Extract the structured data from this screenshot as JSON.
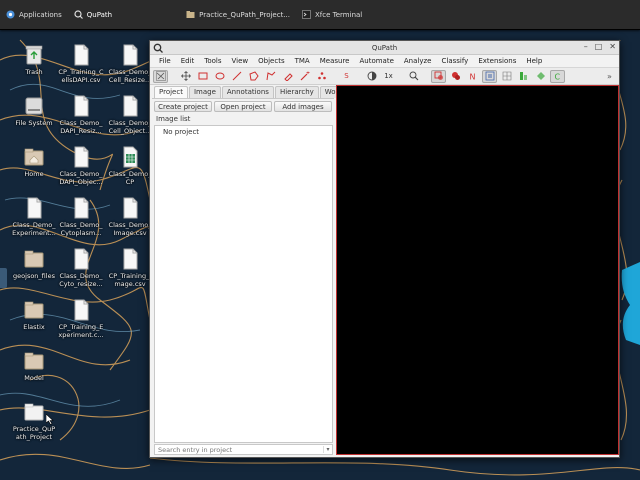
{
  "taskbar": {
    "items": [
      {
        "label": "Applications",
        "icon": "app-menu-icon"
      },
      {
        "label": "QuPath",
        "icon": "qupath-icon"
      },
      {
        "label": "Practice_QuPath_Project...",
        "icon": "folder-icon"
      },
      {
        "label": "Xfce Terminal",
        "icon": "terminal-icon"
      }
    ]
  },
  "desktop": {
    "icons": [
      {
        "label": "Trash",
        "type": "trash"
      },
      {
        "label": "CP_Training_C ellsDAPI.csv",
        "type": "file"
      },
      {
        "label": "Class_Demo_ Cell_Resize...",
        "type": "file"
      },
      {
        "label": "File System",
        "type": "drive"
      },
      {
        "label": "Class_Demo_ DAPI_Resiz...",
        "type": "file"
      },
      {
        "label": "Class_Demo_ Cell_Object...",
        "type": "file"
      },
      {
        "label": "Home",
        "type": "home"
      },
      {
        "label": "Class_Demo_ DAPI_Objec...",
        "type": "file"
      },
      {
        "label": "Class_Demo_ CP",
        "type": "sheet"
      },
      {
        "label": "Class_Demo_ Experiment...",
        "type": "file"
      },
      {
        "label": "Class_Demo_ Cytoplasm...",
        "type": "file"
      },
      {
        "label": "Class_Demo_ Image.csv",
        "type": "file"
      },
      {
        "label": "geojson_files",
        "type": "folder"
      },
      {
        "label": "Class_Demo_ Cyto_resize...",
        "type": "file"
      },
      {
        "label": "CP_Training_I mage.csv",
        "type": "file"
      },
      {
        "label": "Elastix",
        "type": "folder"
      },
      {
        "label": "CP_Training_E xperiment.c...",
        "type": "file"
      },
      {
        "label": "Model",
        "type": "folder"
      },
      {
        "label": "Practice_QuP ath_Project",
        "type": "folder-open"
      }
    ]
  },
  "window": {
    "title": "QuPath",
    "controls": {
      "minimize": "–",
      "maximize": "□",
      "close": "✕"
    },
    "menu": [
      "File",
      "Edit",
      "Tools",
      "View",
      "Objects",
      "TMA",
      "Measure",
      "Automate",
      "Analyze",
      "Classify",
      "Extensions",
      "Help"
    ],
    "toolbar": {
      "tools": [
        "move-tool-icon",
        "rectangle-tool-icon",
        "ellipse-tool-icon",
        "line-tool-icon",
        "polygon-tool-icon",
        "polyline-tool-icon",
        "brush-tool-icon",
        "wand-tool-icon",
        "points-tool-icon"
      ],
      "selection_mode_label": "S",
      "zoom_label": "1x",
      "more_label": "»"
    },
    "left_tabs": [
      "Project",
      "Image",
      "Annotations",
      "Hierarchy",
      "Workflow"
    ],
    "project_buttons": {
      "create": "Create project",
      "open": "Open project",
      "add": "Add images"
    },
    "image_list_label": "Image list",
    "image_list_empty": "No project",
    "search_placeholder": "Search entry in project",
    "search_dropdown": "▾",
    "accent_color": "#c03030"
  }
}
